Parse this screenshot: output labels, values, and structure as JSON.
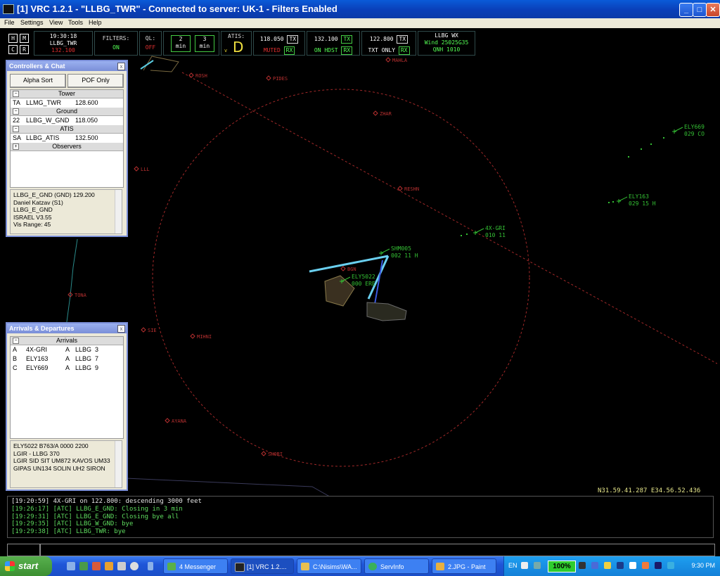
{
  "window": {
    "title": "[1] VRC 1.2.1 - \"LLBG_TWR\" - Connected to server: UK-1 - Filters Enabled"
  },
  "menu": [
    "File",
    "Settings",
    "View",
    "Tools",
    "Help"
  ],
  "header": {
    "keys": [
      "H",
      "M",
      "C",
      "R"
    ],
    "time": "19:30:18",
    "callsign": "LLBG_TWR",
    "prim_freq": "132.100",
    "filters_label": "FILTERS:",
    "filters_value": "ON",
    "ql_label": "QL:",
    "ql_value": "OFF",
    "timer1_val": "2",
    "timer1_unit": "min",
    "timer2_val": "3",
    "timer2_unit": "min",
    "atis_label": "ATIS:",
    "atis_letter": "D",
    "atis_arrow": "v",
    "freqs": [
      {
        "freq": "118.050",
        "status": "MUTED"
      },
      {
        "freq": "132.100",
        "status": "ON HDST"
      },
      {
        "freq": "122.800",
        "status": "TXT ONLY"
      }
    ],
    "tx_label": "TX",
    "rx_label": "RX",
    "wx_title": "LLBG WX",
    "wx_wind": "Wind 25025G35",
    "wx_qnh": "QNH 1010"
  },
  "controllers": {
    "title": "Controllers & Chat",
    "close": "x",
    "alpha_sort": "Alpha Sort",
    "pof_only": "POF Only",
    "tower_group": "Tower",
    "tower": {
      "id": "TA",
      "callsign": "LLMG_TWR",
      "freq": "128.600"
    },
    "ground_group": "Ground",
    "ground": {
      "id": "22",
      "callsign": "LLBG_W_GND",
      "freq": "118.050"
    },
    "atis_group": "ATIS",
    "atis": {
      "id": "SA",
      "callsign": "LLBG_ATIS",
      "freq": "132.500"
    },
    "observers_group": "Observers",
    "minus": "−",
    "plus": "+",
    "info": [
      "LLBG_E_GND (GND) 129.200",
      "Daniel Katzav (S1)",
      "LLBG_E_GND",
      "ISRAEL V3.55",
      "Vis Range: 45"
    ]
  },
  "arrdep": {
    "title": "Arrivals & Departures",
    "close": "x",
    "group": "Arrivals",
    "minus": "−",
    "rows": [
      {
        "letter": "A",
        "callsign": "4X-GRI",
        "type": "A",
        "dest": "LLBG",
        "num": "3"
      },
      {
        "letter": "B",
        "callsign": "ELY163",
        "type": "A",
        "dest": "LLBG",
        "num": "7"
      },
      {
        "letter": "C",
        "callsign": "ELY669",
        "type": "A",
        "dest": "LLBG",
        "num": "9"
      }
    ],
    "info": [
      "ELY5022  B763/A  0000  2200",
      "LGIR - LLBG  370",
      "LGIR SID SIT UM872 KAVOS UM33",
      "GIPAS UN134 SOLIN UH2 SIRON"
    ]
  },
  "radar": {
    "fixes": [
      "ROSH",
      "PIDES",
      "MAHLA",
      "ZHAR",
      "RESHN",
      "LLL",
      "TONA",
      "SIE",
      "MIHNI",
      "AYANA",
      "SHORI",
      "BGN"
    ],
    "traffic": [
      {
        "tag": "ELY669",
        "data": "029 CO"
      },
      {
        "tag": "ELY163",
        "data": "029 15 H"
      },
      {
        "tag": "4X-GRI",
        "data": "010 11"
      },
      {
        "tag": "SHM005",
        "data": "002 11 H"
      },
      {
        "tag": "ELY5022",
        "data": "000 ERE"
      }
    ],
    "coords": "N31.59.41.287 E34.56.52.436"
  },
  "chat": [
    "[19:20:59] 4X-GRI on 122.800: descending 3000 feet",
    "[19:26:17] [ATC] LLBG_E_GND: Closing in 3 min",
    "[19:29:31] [ATC] LLBG_E_GND: Closing bye all",
    "[19:29:35] [ATC] LLBG_W_GND: bye",
    "[19:29:38] [ATC] LLBG_TWR: bye"
  ],
  "taskbar": {
    "start": "start",
    "buttons": [
      "4 Messenger",
      "[1] VRC 1.2....",
      "C:\\Nisims\\WA...",
      "ServInfo",
      "2.JPG - Paint"
    ],
    "lang": "EN",
    "zoom": "100%",
    "clock": "9:30 PM"
  },
  "colors": {
    "scope_bg": "#000000",
    "fix_red": "#b83030",
    "traffic_green": "#34c034",
    "title_blue": "#0a4fcf"
  }
}
